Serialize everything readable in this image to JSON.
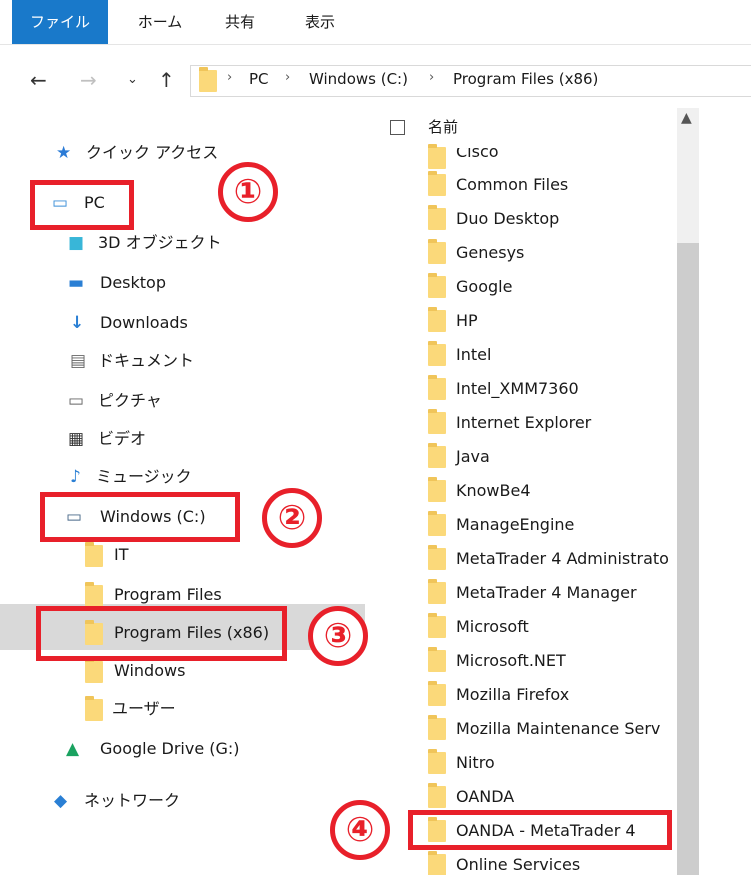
{
  "ribbon": {
    "tabs": [
      {
        "label": "ファイル"
      },
      {
        "label": "ホーム"
      },
      {
        "label": "共有"
      },
      {
        "label": "表示"
      }
    ]
  },
  "address": {
    "crumbs": [
      {
        "label": "PC"
      },
      {
        "label": "Windows (C:)"
      },
      {
        "label": "Program Files (x86)"
      }
    ]
  },
  "nav": {
    "quick_access": "クイック アクセス",
    "pc": "PC",
    "objects3d": "3D オブジェクト",
    "desktop": "Desktop",
    "downloads": "Downloads",
    "documents": "ドキュメント",
    "pictures": "ピクチャ",
    "videos": "ビデオ",
    "music": "ミュージック",
    "windows_c": "Windows (C:)",
    "it": "IT",
    "program_files": "Program Files",
    "program_files_x86": "Program Files (x86)",
    "windows": "Windows",
    "users": "ユーザー",
    "google_drive": "Google Drive (G:)",
    "network": "ネットワーク"
  },
  "list": {
    "header": "名前",
    "items": [
      "Cisco",
      "Common Files",
      "Duo Desktop",
      "Genesys",
      "Google",
      "HP",
      "Intel",
      "Intel_XMM7360",
      "Internet Explorer",
      "Java",
      "KnowBe4",
      "ManageEngine",
      "MetaTrader 4 Administrato",
      "MetaTrader 4 Manager",
      "Microsoft",
      "Microsoft.NET",
      "Mozilla Firefox",
      "Mozilla Maintenance Serv",
      "Nitro",
      "OANDA",
      "OANDA - MetaTrader 4",
      "Online Services"
    ]
  },
  "annotations": {
    "one": "①",
    "two": "②",
    "three": "③",
    "four": "④"
  },
  "colors": {
    "accent": "#1979ca",
    "annotation_red": "#e8202a",
    "folder_yellow": "#fbd97a",
    "selection_gray": "#d9d9d9"
  }
}
